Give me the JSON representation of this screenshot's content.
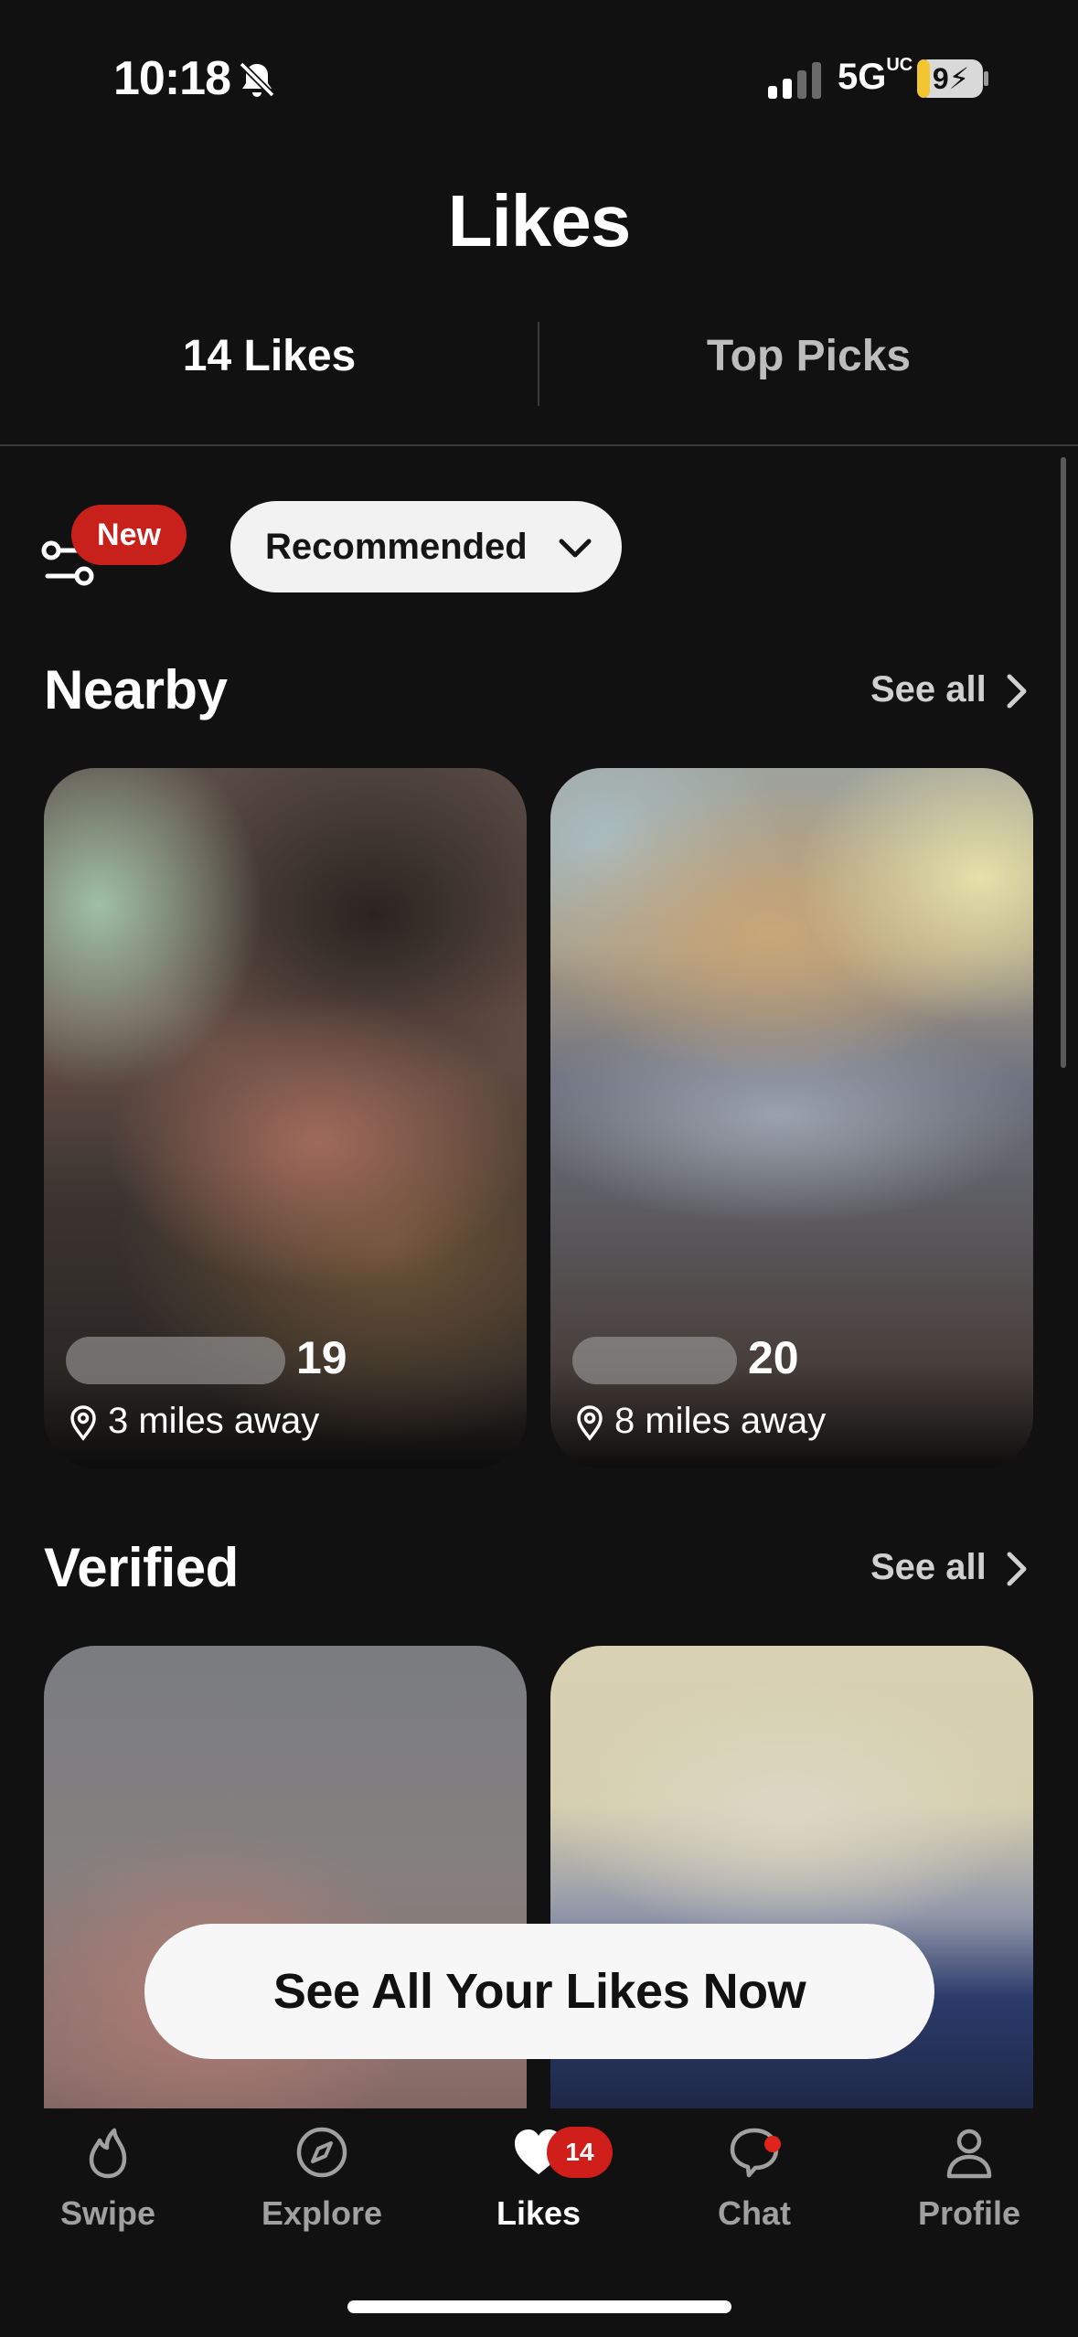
{
  "status_bar": {
    "time": "10:18",
    "network": "5G",
    "network_suffix": "UC",
    "battery": "9"
  },
  "header": {
    "title": "Likes",
    "tabs": [
      {
        "label": "14 Likes",
        "active": true
      },
      {
        "label": "Top Picks",
        "active": false
      }
    ]
  },
  "filters": {
    "new_badge": "New",
    "sort_label": "Recommended"
  },
  "sections": [
    {
      "title": "Nearby",
      "see_all": "See all",
      "cards": [
        {
          "age": "19",
          "distance": "3 miles away"
        },
        {
          "age": "20",
          "distance": "8 miles away"
        }
      ]
    },
    {
      "title": "Verified",
      "see_all": "See all"
    }
  ],
  "cta": {
    "label": "See All Your Likes Now"
  },
  "nav": {
    "items": [
      {
        "label": "Swipe",
        "icon": "flame-icon"
      },
      {
        "label": "Explore",
        "icon": "compass-icon"
      },
      {
        "label": "Likes",
        "icon": "heart-icon",
        "badge": "14",
        "active": true
      },
      {
        "label": "Chat",
        "icon": "chat-bubble-icon"
      },
      {
        "label": "Profile",
        "icon": "person-icon"
      }
    ]
  },
  "colors": {
    "background": "#111111",
    "accent_red": "#d01f1a",
    "pill": "#f2f2f2"
  }
}
